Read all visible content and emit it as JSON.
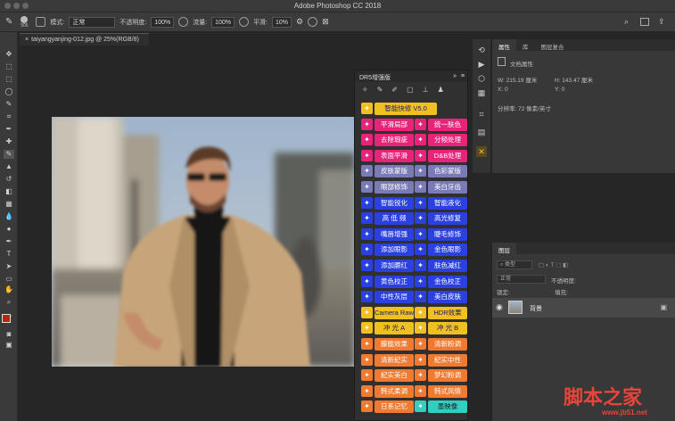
{
  "app": {
    "title": "Adobe Photoshop CC 2018"
  },
  "options": {
    "brush_size": "505",
    "mode_label": "模式:",
    "mode_value": "正常",
    "opacity_label": "不透明度:",
    "opacity_value": "100%",
    "flow_label": "流量:",
    "flow_value": "100%",
    "smooth_label": "平滑:",
    "smooth_value": "10%"
  },
  "document": {
    "tab": "taiyangyanjing-012.jpg @ 25%(RGB/8)"
  },
  "dr5": {
    "title": "DR5增强版",
    "header_arrows": "»",
    "header_menu": "≡",
    "buttons": [
      {
        "label": "智能快修 V5.0",
        "color": "#f0c020",
        "text": "#1a1a6a"
      },
      {
        "label": "平滑局部",
        "color": "#e8247a",
        "text": "#ffffff"
      },
      {
        "label": "统一肤色",
        "color": "#e8247a",
        "text": "#ffffff"
      },
      {
        "label": "去除瑕疵",
        "color": "#e8247a",
        "text": "#ffffff"
      },
      {
        "label": "分频处理",
        "color": "#e8247a",
        "text": "#ffffff"
      },
      {
        "label": "表面平滑",
        "color": "#e8247a",
        "text": "#ffffff"
      },
      {
        "label": "D&B处理",
        "color": "#e8247a",
        "text": "#ffffff"
      },
      {
        "label": "皮肤蒙版",
        "color": "#7a7ab8",
        "text": "#ffffff"
      },
      {
        "label": "色彩蒙版",
        "color": "#7a7ab8",
        "text": "#ffffff"
      },
      {
        "label": "眼部修饰",
        "color": "#7a7ab8",
        "text": "#ffffff"
      },
      {
        "label": "美白牙齿",
        "color": "#7a7ab8",
        "text": "#ffffff"
      },
      {
        "label": "智能锐化",
        "color": "#2a40e0",
        "text": "#ffffff"
      },
      {
        "label": "智能液化",
        "color": "#2a40e0",
        "text": "#ffffff"
      },
      {
        "label": "高 低 频",
        "color": "#2a40e0",
        "text": "#ffffff"
      },
      {
        "label": "高光修复",
        "color": "#2a40e0",
        "text": "#ffffff"
      },
      {
        "label": "嘴唇增强",
        "color": "#2a40e0",
        "text": "#ffffff"
      },
      {
        "label": "睫毛修饰",
        "color": "#2a40e0",
        "text": "#ffffff"
      },
      {
        "label": "添加眼影",
        "color": "#2a40e0",
        "text": "#ffffff"
      },
      {
        "label": "金色眼影",
        "color": "#2a40e0",
        "text": "#ffffff"
      },
      {
        "label": "添加腮红",
        "color": "#2a40e0",
        "text": "#ffffff"
      },
      {
        "label": "肤色减红",
        "color": "#2a40e0",
        "text": "#ffffff"
      },
      {
        "label": "黄色校正",
        "color": "#2a40e0",
        "text": "#ffffff"
      },
      {
        "label": "金色校正",
        "color": "#2a40e0",
        "text": "#ffffff"
      },
      {
        "label": "中性灰层",
        "color": "#2a40e0",
        "text": "#ffffff"
      },
      {
        "label": "美白皮肤",
        "color": "#2a40e0",
        "text": "#ffffff"
      },
      {
        "label": "Camera Raw",
        "color": "#f0c020",
        "text": "#1a1a6a"
      },
      {
        "label": "HDR效果",
        "color": "#f0c020",
        "text": "#1a1a6a"
      },
      {
        "label": "冲 光 A",
        "color": "#f0c020",
        "text": "#1a1a6a"
      },
      {
        "label": "冲 光 B",
        "color": "#f0c020",
        "text": "#1a1a6a"
      },
      {
        "label": "朦胧效果",
        "color": "#f07a30",
        "text": "#ffffff"
      },
      {
        "label": "清新粉调",
        "color": "#f07a30",
        "text": "#ffffff"
      },
      {
        "label": "清新紀实",
        "color": "#f07a30",
        "text": "#ffffff"
      },
      {
        "label": "紀实中性",
        "color": "#f07a30",
        "text": "#ffffff"
      },
      {
        "label": "紀实美白",
        "color": "#f07a30",
        "text": "#ffffff"
      },
      {
        "label": "梦幻粉调",
        "color": "#f07a30",
        "text": "#ffffff"
      },
      {
        "label": "韩式柔调",
        "color": "#f07a30",
        "text": "#ffffff"
      },
      {
        "label": "韩式风情",
        "color": "#f07a30",
        "text": "#ffffff"
      },
      {
        "label": "日系记忆",
        "color": "#f07a30",
        "text": "#ffffff"
      },
      {
        "label": "墨映像",
        "color": "#30d0c0",
        "text": "#1a1a1a"
      }
    ]
  },
  "properties": {
    "tabs": [
      "属性",
      "库",
      "图层复合"
    ],
    "doc_props": "文档属性",
    "w": "W: 215.19 厘米",
    "h": "H: 143.47 厘米",
    "x": "X: 0",
    "y": "Y: 0",
    "resolution": "分辨率: 72 像素/英寸"
  },
  "layers": {
    "tab": "图层",
    "kind": "类型",
    "mode": "正常",
    "opacity": "不透明度:",
    "lock": "锁定:",
    "fill": "填充:",
    "layer_name": "背景"
  },
  "watermark": {
    "text": "脚本之家",
    "url": "www.jb51.net"
  },
  "colors": {
    "fg": "#c0201a",
    "bg": "#ffffff"
  }
}
